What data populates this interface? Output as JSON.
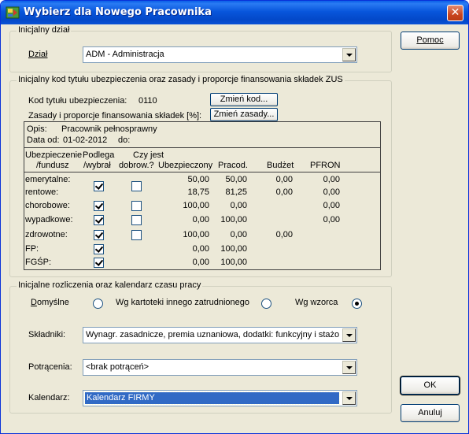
{
  "window": {
    "title": "Wybierz dla Nowego Pracownika"
  },
  "buttons": {
    "help": "Pomoc",
    "ok": "OK",
    "cancel": "Anuluj",
    "change_code": "Zmień kod...",
    "change_rules": "Zmień zasady..."
  },
  "dept_group": {
    "legend": "Inicjalny dział",
    "label": "Dział",
    "value": "ADM - Administracja"
  },
  "zus_group": {
    "legend": "Inicjalny kod tytułu ubezpieczenia oraz zasady i proporcje finansowania składek ZUS",
    "code_label": "Kod tytułu ubezpieczenia:",
    "code_value": "0110",
    "rules_label": "Zasady i proporcje finansowania składek [%]:",
    "desc_label": "Opis:",
    "desc_value": "Pracownik pełnosprawny",
    "date_from_label": "Data od:",
    "date_from_value": "01-02-2012",
    "date_to_label": "do:",
    "headers": {
      "fund_1": "Ubezpieczenie",
      "fund_2": "/fundusz",
      "subject_1": "Podlega",
      "subject_2": "/wybrał",
      "voluntary_1": "Czy jest",
      "voluntary_2": "dobrow.?",
      "insured": "Ubezpieczony",
      "employer": "Pracod.",
      "budget": "Budżet",
      "pfron": "PFRON"
    },
    "rows": [
      {
        "name": "emerytalne:",
        "subject": true,
        "voluntary": false,
        "insured": "50,00",
        "employer": "50,00",
        "budget": "0,00",
        "pfron": "0,00"
      },
      {
        "name": "rentowe:",
        "subject": true,
        "voluntary": false,
        "insured": "18,75",
        "employer": "81,25",
        "budget": "0,00",
        "pfron": "0,00"
      },
      {
        "name": "chorobowe:",
        "subject": true,
        "voluntary": false,
        "insured": "100,00",
        "employer": "0,00",
        "budget": "",
        "pfron": "0,00"
      },
      {
        "name": "wypadkowe:",
        "subject": true,
        "voluntary": false,
        "insured": "0,00",
        "employer": "100,00",
        "budget": "",
        "pfron": "0,00"
      },
      {
        "name": "zdrowotne:",
        "subject": true,
        "voluntary": false,
        "insured": "100,00",
        "employer": "0,00",
        "budget": "0,00",
        "pfron": ""
      },
      {
        "name": "FP:",
        "subject": true,
        "voluntary": null,
        "insured": "0,00",
        "employer": "100,00",
        "budget": "",
        "pfron": ""
      },
      {
        "name": "FGŚP:",
        "subject": true,
        "voluntary": null,
        "insured": "0,00",
        "employer": "100,00",
        "budget": "",
        "pfron": ""
      }
    ]
  },
  "settle_group": {
    "legend": "Inicjalne rozliczenia oraz kalendarz czasu pracy",
    "radio_default": "Domyślne",
    "radio_other": "Wg kartoteki innego zatrudnionego",
    "radio_template": "Wg wzorca",
    "selected_radio": "template",
    "components_label": "Składniki:",
    "components_value": "Wynagr. zasadnicze, premia uznaniowa, dodatki: funkcyjny i stażowy",
    "deductions_label": "Potrącenia:",
    "deductions_value": "<brak potrąceń>",
    "calendar_label": "Kalendarz:",
    "calendar_value": "Kalendarz FIRMY"
  },
  "colors": {
    "titlebar": "#0856dc",
    "dialog_bg": "#ece9d8",
    "selection": "#316ac5",
    "close": "#c9451f"
  }
}
